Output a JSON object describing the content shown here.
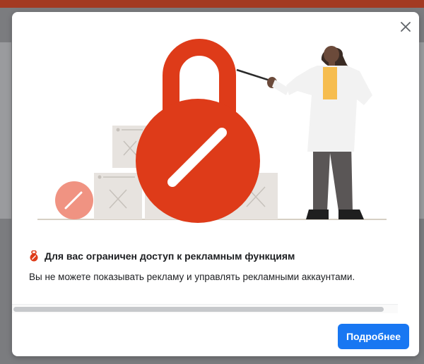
{
  "dialog": {
    "title": "Для вас ограничен доступ к рекламным функциям",
    "description": "Вы не можете показывать рекламу и управлять рекламными аккаунтами.",
    "more_button_label": "Подробнее",
    "colors": {
      "accent": "#1877f2",
      "lock_red": "#de3b19",
      "backdrop": "#7b7c7f"
    }
  },
  "icons": {
    "close": "close-icon",
    "restriction": "restriction-icon"
  }
}
